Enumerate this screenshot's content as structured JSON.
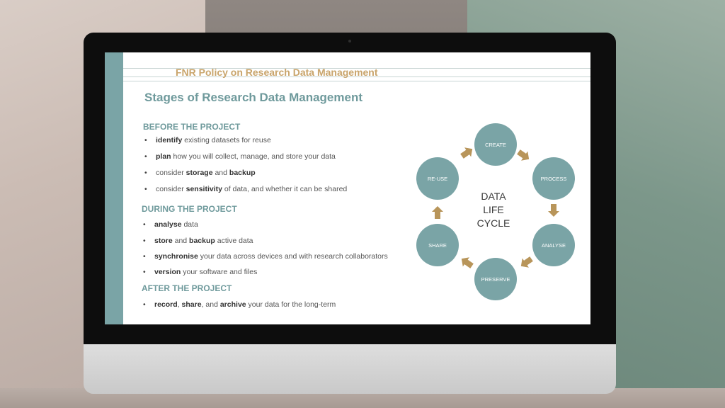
{
  "slide": {
    "doc_title": "FNR Policy on Research Data Management",
    "title": "Stages of Research Data Management",
    "sections": [
      {
        "heading": "BEFORE THE PROJECT",
        "bullets": [
          {
            "bold": "identify",
            "rest": " existing datasets for reuse"
          },
          {
            "bold": "plan",
            "rest": " how you will collect, manage, and store your data"
          },
          {
            "pre": "consider ",
            "bold": "storage",
            "mid": " and ",
            "bold2": "backup"
          },
          {
            "pre": "consider ",
            "bold": "sensitivity",
            "rest": " of data, and whether it can be shared"
          }
        ]
      },
      {
        "heading": "DURING THE PROJECT",
        "bullets": [
          {
            "bold": "analyse",
            "rest": " data"
          },
          {
            "bold": "store",
            "mid": " and ",
            "bold2": "backup",
            "rest": " active data"
          },
          {
            "bold": "synchronise",
            "rest": " your data across devices and with research collaborators"
          },
          {
            "bold": "version",
            "rest": " your software and files"
          }
        ]
      },
      {
        "heading": "AFTER THE PROJECT",
        "bullets": [
          {
            "bold": "record",
            "mid": ", ",
            "bold2": "share",
            "mid2": ", and ",
            "bold3": "archive",
            "rest": " your data for the long-term"
          }
        ]
      }
    ],
    "cycle": {
      "center_lines": [
        "DATA",
        "LIFE",
        "CYCLE"
      ],
      "nodes": [
        "CREATE",
        "PROCESS",
        "ANALYSE",
        "PRESERVE",
        "SHARE",
        "RE-USE"
      ]
    }
  },
  "colors": {
    "accent": "#7aa4a6",
    "doc_title": "#c9a46b",
    "arrow": "#b8955a"
  }
}
